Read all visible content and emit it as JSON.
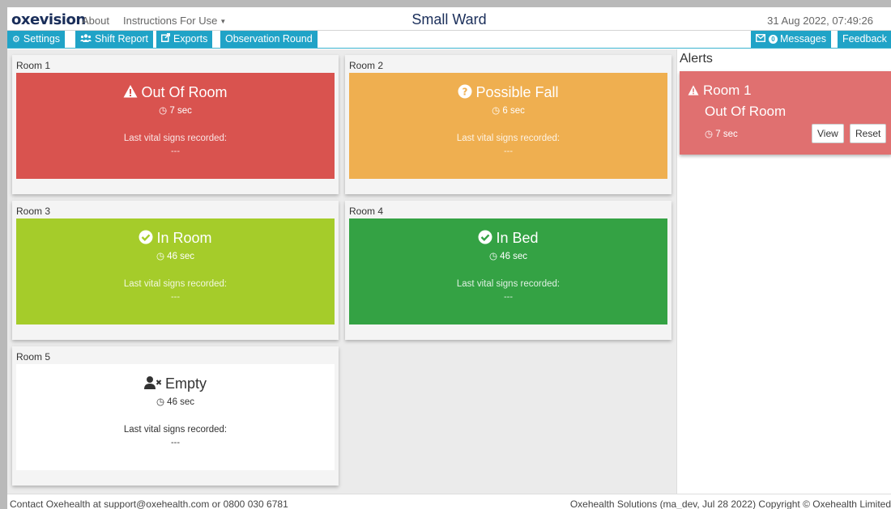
{
  "topbar": {
    "logo": "oxevision",
    "about": "About",
    "instructions": "Instructions For Use",
    "ward_title": "Small Ward",
    "datetime": "31 Aug 2022, 07:49:26"
  },
  "actionbar": {
    "settings": "Settings",
    "shift_report": "Shift Report",
    "exports": "Exports",
    "observation_round": "Observation Round",
    "messages": "Messages",
    "messages_count": "0",
    "feedback": "Feedback"
  },
  "colors": {
    "accent": "#20a3c7",
    "out_of_room": "#d9534f",
    "possible_fall": "#efaf50",
    "in_room": "#a5cc2a",
    "in_bed": "#34a244",
    "alert": "#e07070"
  },
  "rooms": [
    {
      "title": "Room 1",
      "status": "Out Of Room",
      "icon": "warning-icon",
      "elapsed": "7 sec",
      "vitals_label": "Last vital signs recorded:",
      "vitals_value": "---"
    },
    {
      "title": "Room 2",
      "status": "Possible Fall",
      "icon": "question-circle-icon",
      "elapsed": "6 sec",
      "vitals_label": "Last vital signs recorded:",
      "vitals_value": "---"
    },
    {
      "title": "Room 3",
      "status": "In Room",
      "icon": "check-circle-icon",
      "elapsed": "46 sec",
      "vitals_label": "Last vital signs recorded:",
      "vitals_value": "---"
    },
    {
      "title": "Room 4",
      "status": "In Bed",
      "icon": "check-circle-icon",
      "elapsed": "46 sec",
      "vitals_label": "Last vital signs recorded:",
      "vitals_value": "---"
    },
    {
      "title": "Room 5",
      "status": "Empty",
      "icon": "user-times-icon",
      "elapsed": "46 sec",
      "vitals_label": "Last vital signs recorded:",
      "vitals_value": "---"
    }
  ],
  "alerts": {
    "title": "Alerts",
    "items": [
      {
        "room": "Room 1",
        "status": "Out Of Room",
        "elapsed": "7 sec",
        "view_label": "View",
        "reset_label": "Reset"
      }
    ]
  },
  "footer": {
    "contact": "Contact Oxehealth at support@oxehealth.com or 0800 030 6781",
    "copyright": "Oxehealth Solutions (ma_dev, Jul 28 2022) Copyright © Oxehealth Limited"
  }
}
